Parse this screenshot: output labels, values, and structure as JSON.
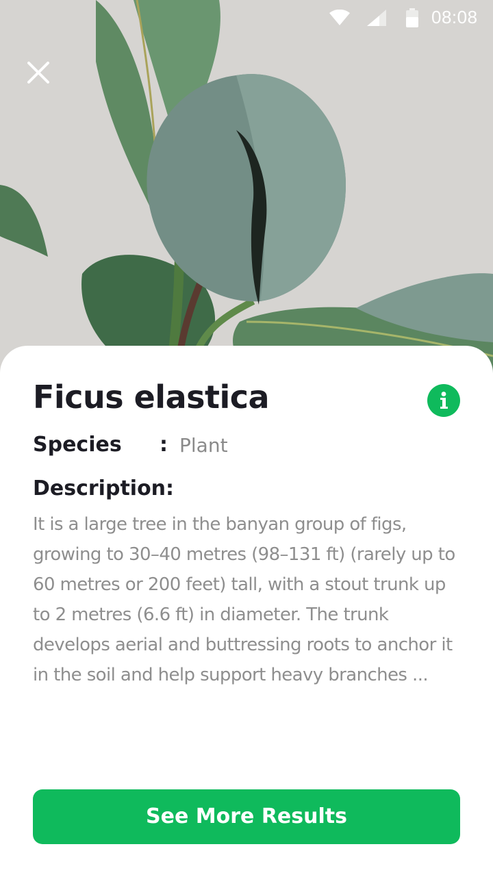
{
  "status_bar": {
    "time": "08:08",
    "icons": [
      "wifi-icon",
      "cell-signal-icon",
      "battery-icon"
    ]
  },
  "hero": {
    "image_subject": "rubber plant leaves photo",
    "close_icon": "close-icon"
  },
  "result": {
    "title": "Ficus elastica",
    "info_icon": "info-icon",
    "species_label": "Species",
    "species_separator": ":",
    "species_value": "Plant",
    "description_label": "Description:",
    "description_text": "It is a large tree in the banyan group of figs, growing to 30–40 metres (98–131 ft) (rarely up to 60 metres or 200 feet) tall, with a stout trunk up to 2 metres (6.6 ft) in diameter. The trunk develops aerial and buttressing roots to anchor it in the soil and help support heavy branches ..."
  },
  "actions": {
    "see_more_label": "See More Results"
  },
  "colors": {
    "accent": "#0fba5c",
    "title": "#1c1c24",
    "muted_text": "#8e8e8e"
  }
}
